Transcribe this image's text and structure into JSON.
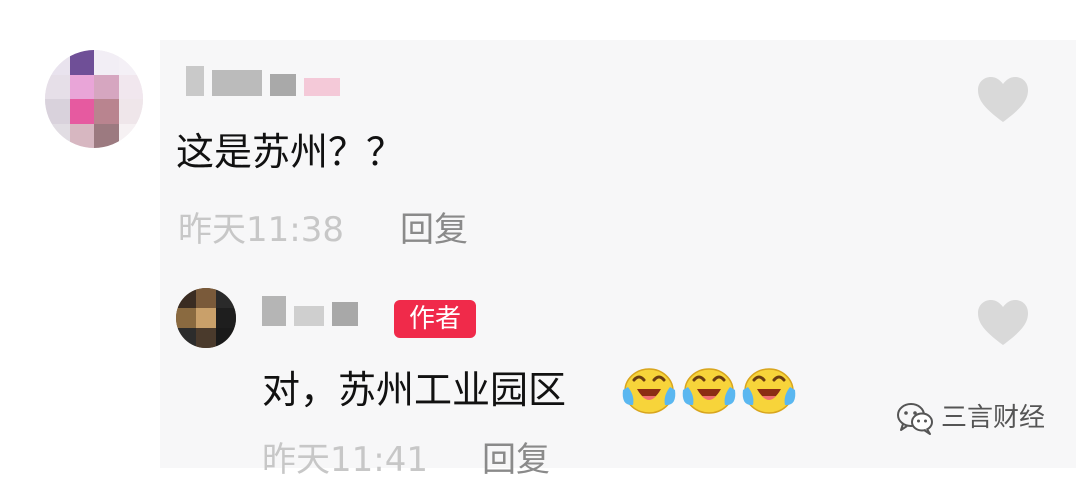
{
  "comments": [
    {
      "text": "这是苏州？？",
      "time": "昨天11:38",
      "reply_label": "回复"
    },
    {
      "author_badge": "作者",
      "text": "对，苏州工业园区",
      "emojis": [
        "crying-laughing-emoji",
        "crying-laughing-emoji",
        "crying-laughing-emoji"
      ],
      "time": "昨天11:41",
      "reply_label": "回复"
    }
  ],
  "icons": {
    "like": "heart-icon",
    "watermark": "wechat-icon"
  },
  "watermark": {
    "text": "三言财经"
  },
  "colors": {
    "author_badge": "#f02a4a",
    "heart": "#d9d9d9",
    "time_text": "#c7c7c7",
    "reply_text": "#8a8a8a",
    "panel_background": "#f7f7f8"
  }
}
